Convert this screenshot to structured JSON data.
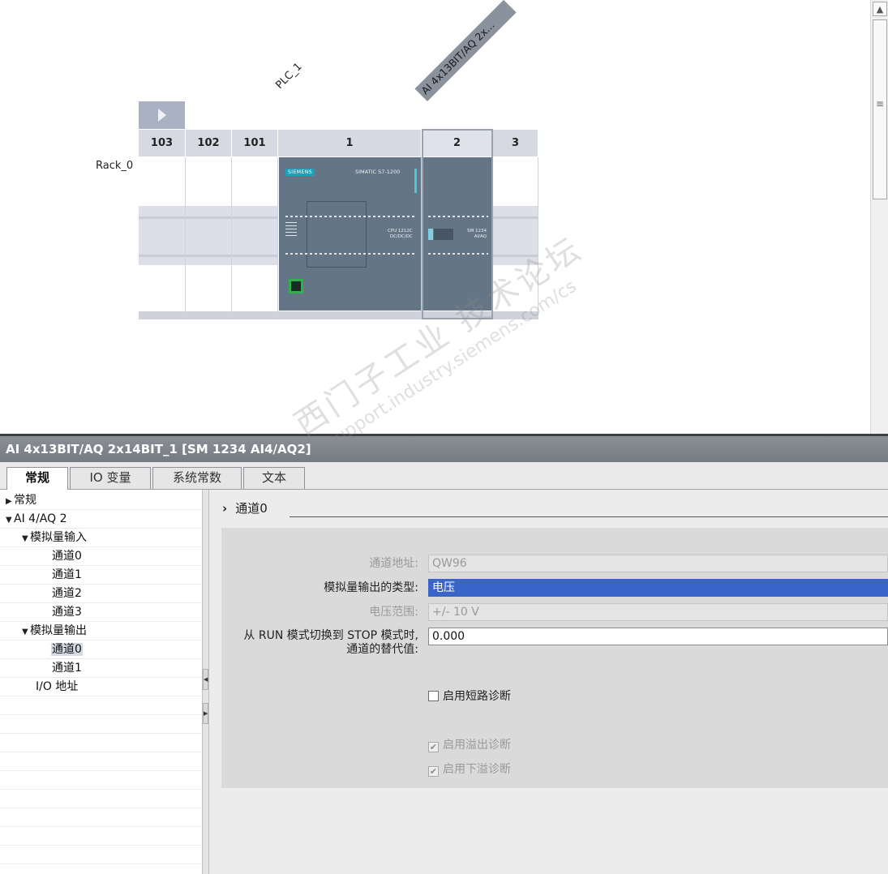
{
  "device_view": {
    "plc_label": "PLC_1",
    "module_tag": "AI 4x13BIT/AQ 2x...",
    "rack_name": "Rack_0",
    "slots": [
      "103",
      "102",
      "101",
      "1",
      "2",
      "3"
    ],
    "cpu": {
      "brand": "SIEMENS",
      "model": "SIMATIC S7-1200",
      "name_line1": "CPU 1212C",
      "name_line2": "DC/DC/DC"
    },
    "sm": {
      "name_line1": "SM 1234",
      "name_line2": "AI/AQ"
    }
  },
  "properties": {
    "title": "AI 4x13BIT/AQ 2x14BIT_1 [SM 1234 AI4/AQ2]",
    "tabs": [
      {
        "label": "常规"
      },
      {
        "label": "IO 变量"
      },
      {
        "label": "系统常数"
      },
      {
        "label": "文本"
      }
    ],
    "tree": [
      {
        "label": "常规",
        "arrow": "▶"
      },
      {
        "label": "AI 4/AQ 2",
        "arrow": "▼"
      },
      {
        "label": "模拟量输入",
        "arrow": "▼"
      },
      {
        "label": "通道0",
        "arrow": ""
      },
      {
        "label": "通道1",
        "arrow": ""
      },
      {
        "label": "通道2",
        "arrow": ""
      },
      {
        "label": "通道3",
        "arrow": ""
      },
      {
        "label": "模拟量输出",
        "arrow": "▼"
      },
      {
        "label": "通道0",
        "arrow": ""
      },
      {
        "label": "通道1",
        "arrow": ""
      },
      {
        "label": "I/O 地址",
        "arrow": ""
      }
    ],
    "section_title": "通道0",
    "fields": {
      "channel_address_label": "通道地址:",
      "channel_address_value": "QW96",
      "output_type_label": "模拟量输出的类型:",
      "output_type_value": "电压",
      "voltage_range_label": "电压范围:",
      "voltage_range_value": "+/- 10 V",
      "substitute_label_line1": "从 RUN 模式切换到 STOP 模式时,",
      "substitute_label_line2": "通道的替代值:",
      "substitute_value": "0.000"
    },
    "checkboxes": {
      "short_circuit": "启用短路诊断",
      "overflow": "启用溢出诊断",
      "underflow": "启用下溢诊断"
    }
  },
  "watermark": {
    "line1": "西门子工业  技术论坛",
    "line2": "support.industry.siemens.com/cs"
  }
}
